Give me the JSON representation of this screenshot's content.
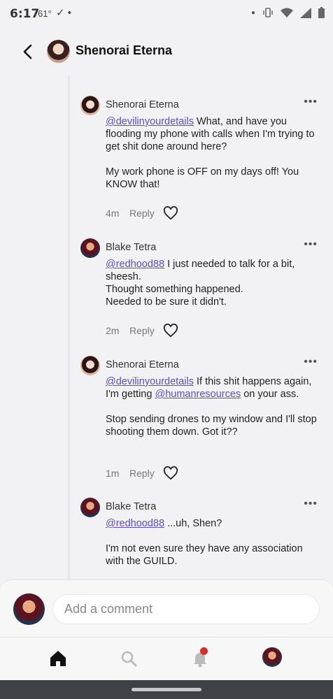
{
  "status_bar": {
    "time": "6:17",
    "temperature": "61°",
    "left_icons": "✓ •",
    "right_icons": [
      "dot",
      "vibrate-icon",
      "wifi-icon",
      "signal-icon",
      "battery-icon"
    ]
  },
  "header": {
    "title": "Shenorai Eterna"
  },
  "comments": [
    {
      "author": "Shenorai Eterna",
      "mention": "@devilinyourdetails",
      "text1": " What, and have you flooding my phone with calls when I'm trying to get shit done around here?",
      "text2": "My work phone is OFF on my days off! You KNOW that!",
      "time": "4m",
      "reply": "Reply"
    },
    {
      "author": "Blake Tetra",
      "mention": "@redhood88",
      "text1": " I just needed to talk for a bit, sheesh.",
      "line2": "Thought something happened.",
      "line3": "Needed to be sure it didn't.",
      "time": "2m",
      "reply": "Reply"
    },
    {
      "author": "Shenorai Eterna",
      "mention": "@devilinyourdetails",
      "text1": " If this shit happens again, I'm getting ",
      "mention2": "@humanresources",
      "text1b": " on your ass.",
      "text2": "Stop sending drones to my window and I'll stop shooting them down. Got it??",
      "time": "1m",
      "reply": "Reply"
    },
    {
      "author": "Blake Tetra",
      "mention": "@redhood88",
      "text1": " ...uh, Shen?",
      "text2": "I'm not even sure they have any association with the GUILD."
    }
  ],
  "comment_bar": {
    "placeholder": "Add a comment"
  },
  "bottom_nav": [
    "home-icon",
    "search-icon",
    "bell-icon",
    "profile-avatar"
  ],
  "colors": {
    "mention": "#5a4fbd",
    "notification_dot": "#d62d2d",
    "background": "#f2f2f4"
  }
}
